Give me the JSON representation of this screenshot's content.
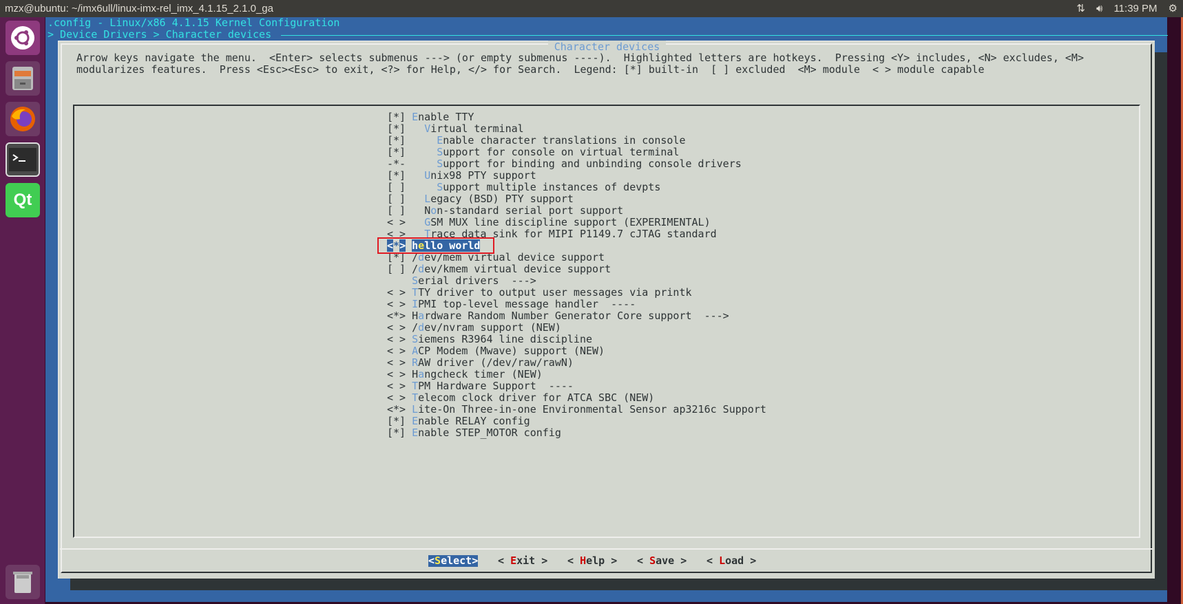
{
  "window_title": "mzx@ubuntu: ~/imx6ull/linux-imx-rel_imx_4.1.15_2.1.0_ga",
  "tray": {
    "network_icon": "network-updown-icon",
    "volume_icon": "volume-icon",
    "clock": "11:39 PM",
    "settings_icon": "gear-icon"
  },
  "launcher": [
    "ubuntu-dash-icon",
    "files-icon",
    "firefox-icon",
    "terminal-icon",
    "qt-creator-icon",
    "trash-icon"
  ],
  "terminal": {
    "header": ".config - Linux/x86 4.1.15 Kernel Configuration",
    "breadcrumb": "> Device Drivers > Character devices",
    "dialog_title": "Character devices",
    "help_line1": "Arrow keys navigate the menu.  <Enter> selects submenus ---> (or empty submenus ----).  Highlighted letters are hotkeys.  Pressing <Y> includes, <N> excludes, <M>",
    "help_line2": "modularizes features.  Press <Esc><Esc> to exit, <?> for Help, </> for Search.  Legend: [*] built-in  [ ] excluded  <M> module  < > module capable",
    "items": [
      {
        "state": "[*]",
        "depth": 0,
        "label": "Enable TTY",
        "key": 0
      },
      {
        "state": "[*]",
        "depth": 1,
        "label": "Virtual terminal",
        "key": 0
      },
      {
        "state": "[*]",
        "depth": 2,
        "label": "Enable character translations in console",
        "key": 0
      },
      {
        "state": "[*]",
        "depth": 2,
        "label": "Support for console on virtual terminal",
        "key": 0
      },
      {
        "state": "-*-",
        "depth": 2,
        "label": "Support for binding and unbinding console drivers",
        "key": 0
      },
      {
        "state": "[*]",
        "depth": 1,
        "label": "Unix98 PTY support",
        "key": 0
      },
      {
        "state": "[ ]",
        "depth": 2,
        "label": "Support multiple instances of devpts",
        "key": 0
      },
      {
        "state": "[ ]",
        "depth": 1,
        "label": "Legacy (BSD) PTY support",
        "key": 0
      },
      {
        "state": "[ ]",
        "depth": 1,
        "label": "Non-standard serial port support",
        "key": 1
      },
      {
        "state": "< >",
        "depth": 1,
        "label": "GSM MUX line discipline support (EXPERIMENTAL)",
        "key": 0
      },
      {
        "state": "< >",
        "depth": 1,
        "label": "Trace data sink for MIPI P1149.7 cJTAG standard",
        "key": 0
      },
      {
        "state": "<*>",
        "depth": 0,
        "label": "hello world",
        "key": 1,
        "selected": true
      },
      {
        "state": "[*]",
        "depth": 0,
        "label": "/dev/mem virtual device support",
        "key": 1
      },
      {
        "state": "[ ]",
        "depth": 0,
        "label": "/dev/kmem virtual device support",
        "key": 1
      },
      {
        "state": "   ",
        "depth": 0,
        "label": "Serial drivers  --->",
        "key": 0
      },
      {
        "state": "< >",
        "depth": 0,
        "label": "TTY driver to output user messages via printk",
        "key": 0
      },
      {
        "state": "< >",
        "depth": 0,
        "label": "IPMI top-level message handler  ----",
        "key": 0
      },
      {
        "state": "<*>",
        "depth": 0,
        "label": "Hardware Random Number Generator Core support  --->",
        "key": 1
      },
      {
        "state": "< >",
        "depth": 0,
        "label": "/dev/nvram support (NEW)",
        "key": 1
      },
      {
        "state": "< >",
        "depth": 0,
        "label": "Siemens R3964 line discipline",
        "key": 0
      },
      {
        "state": "< >",
        "depth": 0,
        "label": "ACP Modem (Mwave) support (NEW)",
        "key": 0
      },
      {
        "state": "< >",
        "depth": 0,
        "label": "RAW driver (/dev/raw/rawN)",
        "key": 0
      },
      {
        "state": "< >",
        "depth": 0,
        "label": "Hangcheck timer (NEW)",
        "key": 1
      },
      {
        "state": "< >",
        "depth": 0,
        "label": "TPM Hardware Support  ----",
        "key": 0
      },
      {
        "state": "< >",
        "depth": 0,
        "label": "Telecom clock driver for ATCA SBC (NEW)",
        "key": 0
      },
      {
        "state": "<*>",
        "depth": 0,
        "label": "Lite-On Three-in-one Environmental Sensor ap3216c Support",
        "key": 0
      },
      {
        "state": "[*]",
        "depth": 0,
        "label": "Enable RELAY config",
        "key": 0
      },
      {
        "state": "[*]",
        "depth": 0,
        "label": "Enable STEP_MOTOR config",
        "key": 0
      }
    ],
    "buttons": [
      {
        "pre": "<",
        "key": "S",
        "rest": "elect",
        "post": ">",
        "active": true
      },
      {
        "pre": "< ",
        "key": "E",
        "rest": "xit",
        "post": " >"
      },
      {
        "pre": "< ",
        "key": "H",
        "rest": "elp",
        "post": " >"
      },
      {
        "pre": "< ",
        "key": "S",
        "rest": "ave",
        "post": " >"
      },
      {
        "pre": "< ",
        "key": "L",
        "rest": "oad",
        "post": " >"
      }
    ]
  },
  "colors": {
    "terminal_bg": "#3465a4",
    "dialog_bg": "#d3d7cf",
    "hotkey": "#6c9bd2",
    "highlight_box": "#e01b24"
  }
}
